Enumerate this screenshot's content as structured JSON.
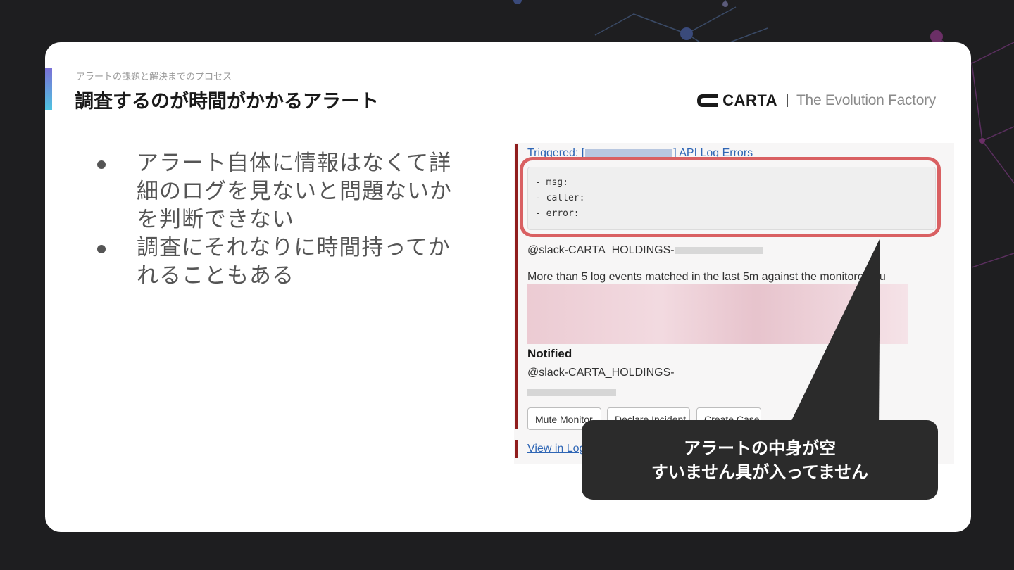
{
  "slide": {
    "kicker": "アラートの課題と解決までのプロセス",
    "title": "調査するのが時間がかかるアラート",
    "brand": {
      "name": "CARTA",
      "tagline": "The Evolution Factory"
    }
  },
  "bullets": [
    "アラート自体に情報はなくて詳細のログを見ないと問題ないかを判断できない",
    "調査にそれなりに時間持ってかれることもある"
  ],
  "screenshot": {
    "trigger_prefix": "Triggered: [",
    "trigger_suffix": "] API Log Errors",
    "code_lines": [
      "- msg:",
      "- caller:",
      "- error:"
    ],
    "mention": "@slack-CARTA_HOLDINGS-",
    "description": "More than 5 log events matched in the last 5m against the monitored qu",
    "notified_label": "Notified",
    "notified_mention": "@slack-CARTA_HOLDINGS-",
    "buttons": [
      "Mute Monitor",
      "Declare Incident",
      "Create Case"
    ],
    "view_link": "View in Log"
  },
  "callout": {
    "line1": "アラートの中身が空",
    "line2": "すいません具が入ってません"
  },
  "colors": {
    "background": "#1e1e20",
    "highlight": "#d96062",
    "link": "#2f66b5",
    "alert_bar": "#8f1d1d"
  }
}
